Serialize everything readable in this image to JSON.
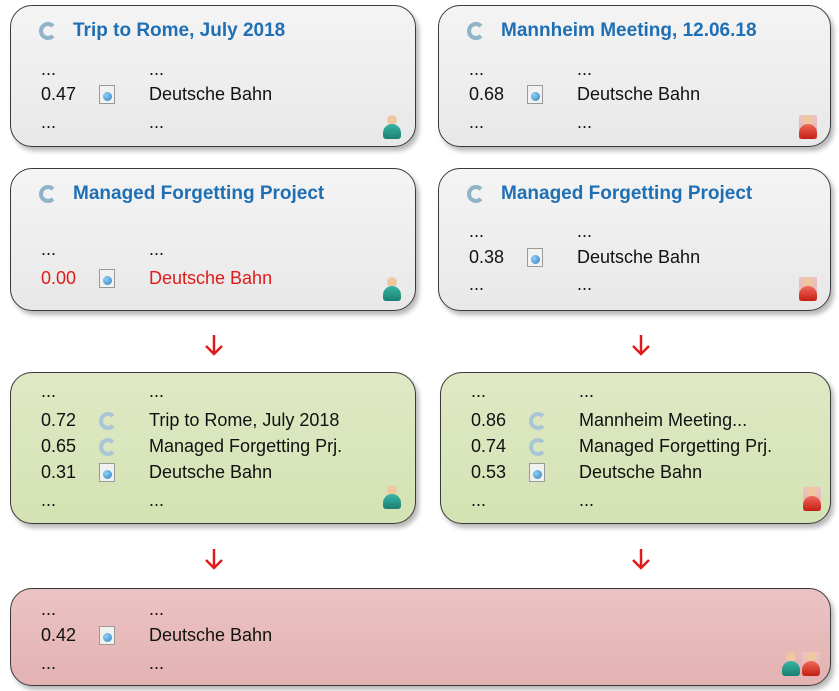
{
  "cards": {
    "c1": {
      "title": "Trip to Rome, July 2018",
      "rows": [
        {
          "score": "...",
          "name": "..."
        },
        {
          "score": "0.47",
          "name": "Deutsche Bahn"
        },
        {
          "score": "...",
          "name": "..."
        }
      ]
    },
    "c2": {
      "title": "Mannheim Meeting, 12.06.18",
      "rows": [
        {
          "score": "...",
          "name": "..."
        },
        {
          "score": "0.68",
          "name": "Deutsche Bahn"
        },
        {
          "score": "...",
          "name": "..."
        }
      ]
    },
    "c3": {
      "title": "Managed Forgetting Project",
      "rows": [
        {
          "score": "...",
          "name": "..."
        },
        {
          "score": "0.00",
          "name": "Deutsche Bahn"
        }
      ]
    },
    "c4": {
      "title": "Managed Forgetting Project",
      "rows": [
        {
          "score": "...",
          "name": "..."
        },
        {
          "score": "0.38",
          "name": "Deutsche Bahn"
        },
        {
          "score": "...",
          "name": "..."
        }
      ]
    },
    "c5": {
      "rows": [
        {
          "score": "...",
          "name": "..."
        },
        {
          "score": "0.72",
          "name": "Trip to Rome, July 2018"
        },
        {
          "score": "0.65",
          "name": "Managed Forgetting Prj."
        },
        {
          "score": "0.31",
          "name": "Deutsche Bahn"
        },
        {
          "score": "...",
          "name": "..."
        }
      ]
    },
    "c6": {
      "rows": [
        {
          "score": "...",
          "name": "..."
        },
        {
          "score": "0.86",
          "name": "Mannheim Meeting..."
        },
        {
          "score": "0.74",
          "name": "Managed Forgetting Prj."
        },
        {
          "score": "0.53",
          "name": "Deutsche Bahn"
        },
        {
          "score": "...",
          "name": "..."
        }
      ]
    },
    "c7": {
      "rows": [
        {
          "score": "...",
          "name": "..."
        },
        {
          "score": "0.42",
          "name": "Deutsche Bahn"
        },
        {
          "score": "...",
          "name": "..."
        }
      ]
    }
  },
  "icons": {
    "semantic_graph": "semantic-graph-icon",
    "web_document": "web-document-icon",
    "user_a": "person-teal-icon",
    "user_b": "person-red-icon",
    "arrow": "down-arrow-icon"
  },
  "colors": {
    "title_blue": "#1f6fb5",
    "highlight_red": "#e01b1b",
    "gray_card": "#ececec",
    "green_card": "#d8e5b9",
    "red_card": "#e7b9b9",
    "arrow_red": "#e01b1b"
  }
}
